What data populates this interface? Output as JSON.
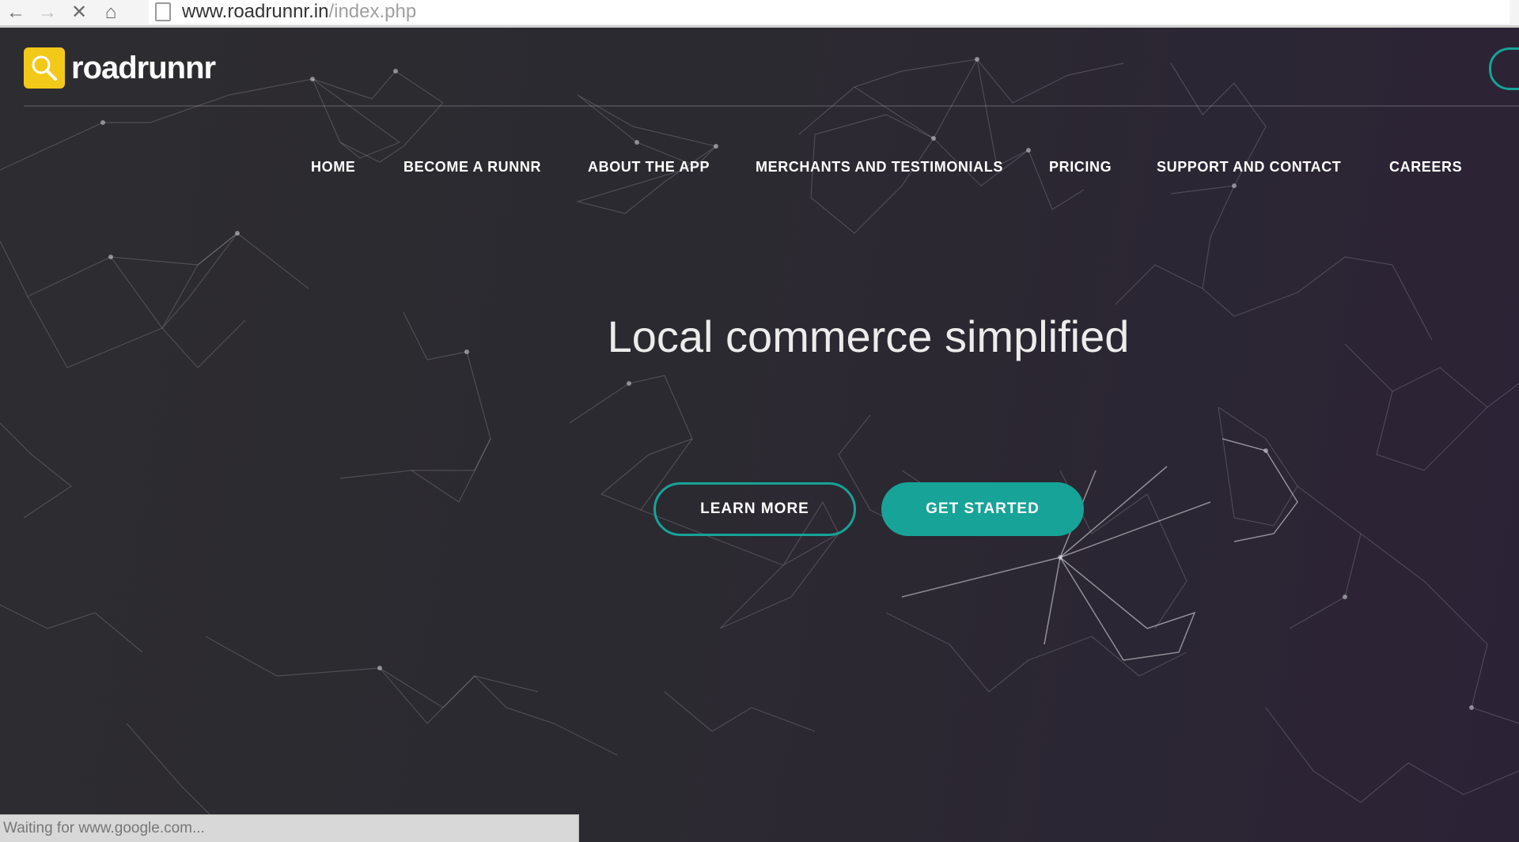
{
  "browser": {
    "url_host": "www.roadrunnr.in",
    "url_path": "/index.php",
    "status_text": "Waiting for www.google.com..."
  },
  "site": {
    "logo_text": "roadrunnr",
    "logo_color": "#f2c919",
    "accent_color": "#17a398"
  },
  "nav": {
    "items": [
      {
        "label": "HOME"
      },
      {
        "label": "BECOME A RUNNR"
      },
      {
        "label": "ABOUT THE APP"
      },
      {
        "label": "MERCHANTS AND TESTIMONIALS"
      },
      {
        "label": "PRICING"
      },
      {
        "label": "SUPPORT AND CONTACT"
      },
      {
        "label": "CAREERS"
      }
    ]
  },
  "hero": {
    "headline": "Local commerce simplified",
    "learn_more_label": "LEARN MORE",
    "get_started_label": "GET STARTED"
  }
}
